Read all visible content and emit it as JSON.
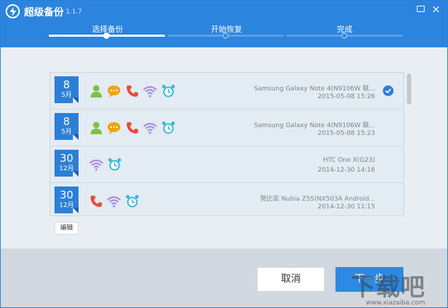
{
  "app": {
    "title": "超级备份",
    "version": "1.1.7"
  },
  "header": {
    "message_icon": "message-icon",
    "close_icon": "close-icon"
  },
  "steps": [
    {
      "label": "选择备份",
      "state": "active"
    },
    {
      "label": "开始恢复",
      "state": "inactive"
    },
    {
      "label": "完成",
      "state": "inactive"
    }
  ],
  "colors": {
    "accent": "#2b84de",
    "contact": "#7cc144",
    "message": "#f2a20c",
    "call": "#e94a3c",
    "wifi": "#a98ae0",
    "alarm": "#33b9d6",
    "check": "#2c7fd6"
  },
  "backups": [
    {
      "day": "8",
      "month": "5月",
      "icons": [
        "contact-icon",
        "message-icon",
        "call-icon",
        "wifi-icon",
        "alarm-icon"
      ],
      "device": "Samsung Galaxy Note 4(N9106W 联...",
      "time": "2015-05-08 15:26",
      "selected": true
    },
    {
      "day": "8",
      "month": "5月",
      "icons": [
        "contact-icon",
        "message-icon",
        "call-icon",
        "wifi-icon",
        "alarm-icon"
      ],
      "device": "Samsung Galaxy Note 4(N9106W 联...",
      "time": "2015-05-08 15:23",
      "selected": false
    },
    {
      "day": "30",
      "month": "12月",
      "icons": [
        "wifi-icon",
        "alarm-icon"
      ],
      "device": "HTC One X(G23)",
      "time": "2014-12-30 14:16",
      "selected": false
    },
    {
      "day": "30",
      "month": "12月",
      "icons": [
        "call-icon",
        "wifi-icon",
        "alarm-icon"
      ],
      "device": "努比亚 Nubia Z5S(NX503A    Android...",
      "time": "2014-12-30 11:15",
      "selected": false
    }
  ],
  "buttons": {
    "edit": "编辑",
    "cancel": "取消",
    "next": "下一步"
  },
  "watermark": {
    "text": "下载吧",
    "url": "www.xiazaiba.com"
  }
}
